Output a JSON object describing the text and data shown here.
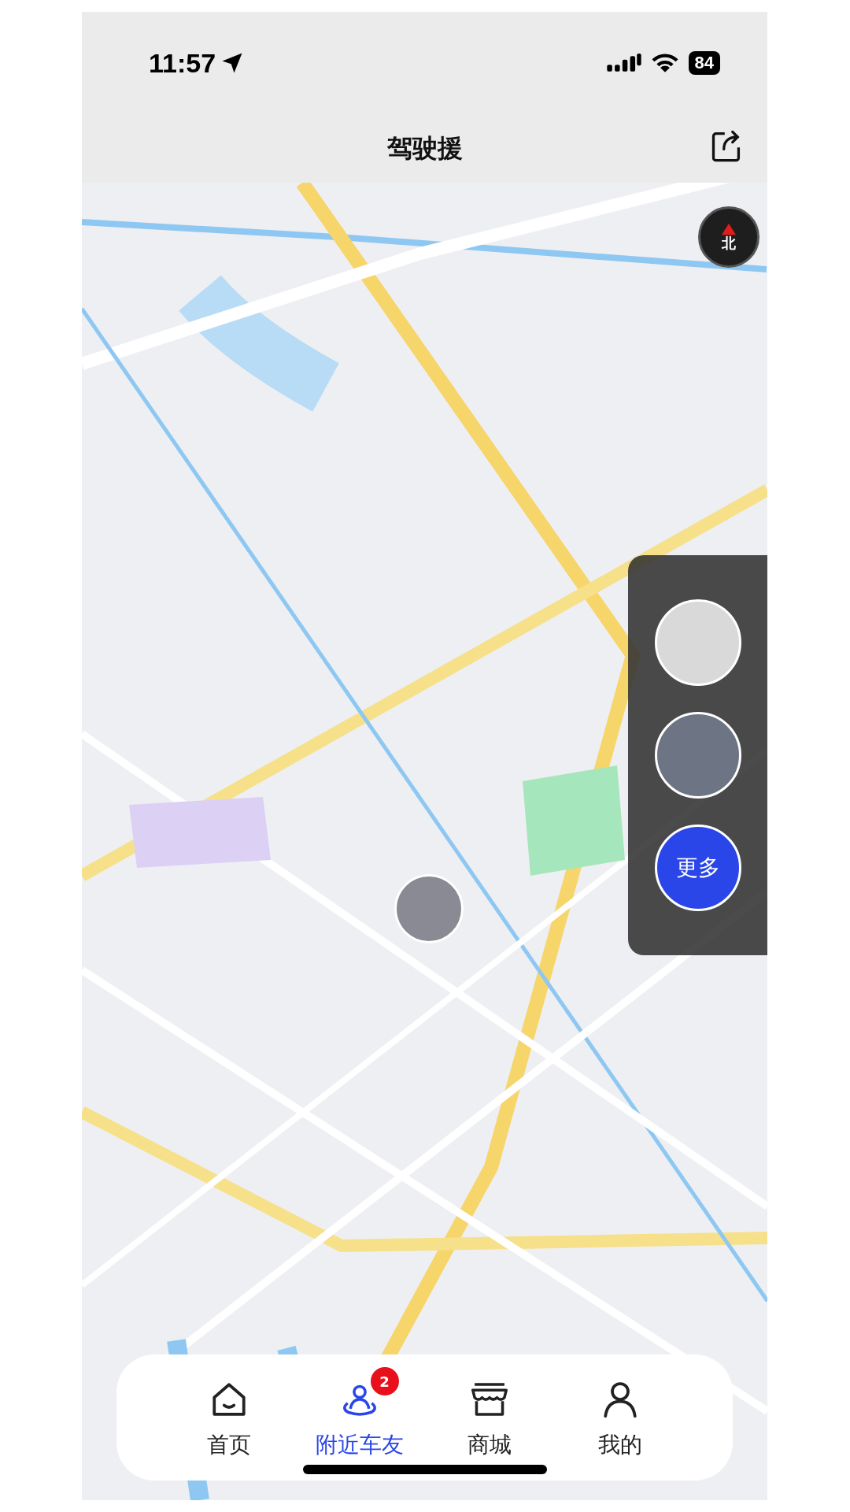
{
  "status_bar": {
    "time": "11:57",
    "battery": "84"
  },
  "header": {
    "title": "驾驶援"
  },
  "map": {
    "compass": "北"
  },
  "side_panel": {
    "more_button": "更多"
  },
  "tabs": [
    {
      "kind": "home",
      "label": "首页",
      "selected": false
    },
    {
      "kind": "nearby",
      "label": "附近车友",
      "selected": true,
      "badge": "2"
    },
    {
      "kind": "shop",
      "label": "商城",
      "selected": false
    },
    {
      "kind": "profile",
      "label": "我的",
      "selected": false
    }
  ]
}
